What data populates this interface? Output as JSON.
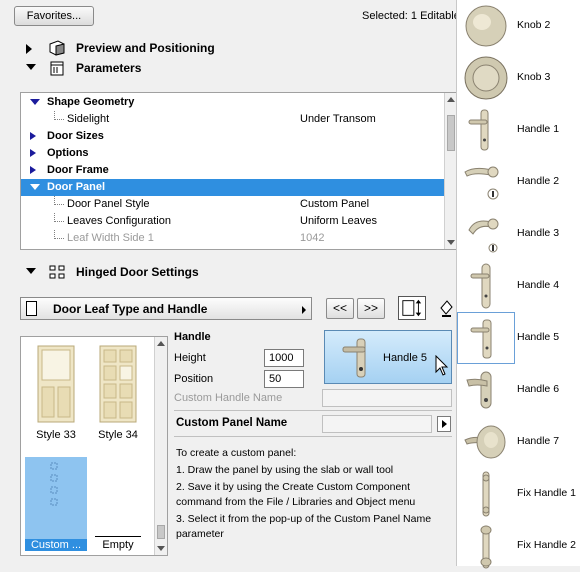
{
  "toolbar": {
    "favorites_label": "Favorites...",
    "selected_text": "Selected: 1 Editable"
  },
  "sections": {
    "preview": "Preview and Positioning",
    "parameters": "Parameters",
    "hinged": "Hinged Door Settings"
  },
  "tree": {
    "rows": [
      {
        "type": "group",
        "label": "Shape Geometry",
        "expanded": true
      },
      {
        "type": "child",
        "label": "Sidelight",
        "value": "Under Transom"
      },
      {
        "type": "group",
        "label": "Door Sizes",
        "expanded": false
      },
      {
        "type": "group",
        "label": "Options",
        "expanded": false
      },
      {
        "type": "group",
        "label": "Door Frame",
        "expanded": false
      },
      {
        "type": "group",
        "label": "Door Panel",
        "expanded": true,
        "selected": true
      },
      {
        "type": "child",
        "label": "Door Panel Style",
        "value": "Custom Panel"
      },
      {
        "type": "child",
        "label": "Leaves Configuration",
        "value": "Uniform Leaves"
      },
      {
        "type": "child",
        "label": "Leaf Width Side 1",
        "value": "1042",
        "disabled": true
      }
    ]
  },
  "page": {
    "selector_label": "Door Leaf Type and Handle",
    "prev_label": "<<",
    "next_label": ">>"
  },
  "gallery": {
    "items": [
      {
        "label": "Style 33"
      },
      {
        "label": "Style 34"
      },
      {
        "label": "Custom ...",
        "selected": true
      },
      {
        "label": "Empty"
      }
    ]
  },
  "handle": {
    "title": "Handle",
    "height_label": "Height",
    "height_value": "1000",
    "position_label": "Position",
    "position_value": "50",
    "custom_name_label": "Custom Handle Name",
    "custom_name_value": "",
    "preview_label": "Handle 5"
  },
  "custom_panel": {
    "title": "Custom Panel Name",
    "value": "",
    "lines": [
      "To create a custom panel:",
      "1. Draw the panel by using the slab or wall tool",
      "2. Save it by using the Create Custom Component",
      "command from the File / Libraries and Object menu",
      "3. Select it from the pop-up of the Custom Panel Name",
      "parameter"
    ]
  },
  "catalog": {
    "items": [
      {
        "label": "Knob 2",
        "kind": "knob"
      },
      {
        "label": "Knob 3",
        "kind": "knob"
      },
      {
        "label": "Handle 1",
        "kind": "plate"
      },
      {
        "label": "Handle 2",
        "kind": "lever-rose"
      },
      {
        "label": "Handle 3",
        "kind": "lever-rose"
      },
      {
        "label": "Handle 4",
        "kind": "plate"
      },
      {
        "label": "Handle 5",
        "kind": "plate",
        "selected": true
      },
      {
        "label": "Handle 6",
        "kind": "plate"
      },
      {
        "label": "Handle 7",
        "kind": "knob-lever"
      },
      {
        "label": "Fix Handle 1",
        "kind": "fixed"
      },
      {
        "label": "Fix Handle 2",
        "kind": "fixed"
      }
    ]
  },
  "colors": {
    "selection": "#2f8fe0",
    "tree_triangle": "#1b1b9c",
    "preview_bg": "#a5d1f2"
  }
}
